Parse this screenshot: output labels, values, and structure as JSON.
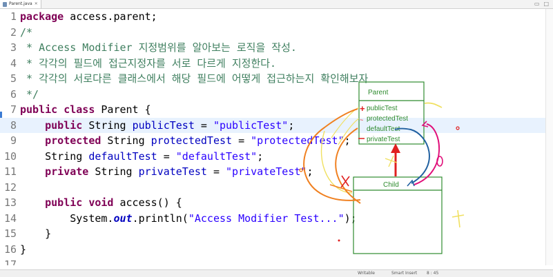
{
  "tab": {
    "title": "Parent.java",
    "close": "✕"
  },
  "window": {
    "minimize": "▭",
    "maximize": "□"
  },
  "editor": {
    "current_line": 8,
    "lines": [
      {
        "n": "1"
      },
      {
        "n": "2"
      },
      {
        "n": "3"
      },
      {
        "n": "4"
      },
      {
        "n": "5"
      },
      {
        "n": "6"
      },
      {
        "n": "7"
      },
      {
        "n": "8"
      },
      {
        "n": "9"
      },
      {
        "n": "10"
      },
      {
        "n": "11"
      },
      {
        "n": "12"
      },
      {
        "n": "13"
      },
      {
        "n": "14"
      },
      {
        "n": "15"
      },
      {
        "n": "16"
      },
      {
        "n": "17"
      }
    ],
    "tokens": {
      "package_kw": "package",
      "package_name": " access.parent;",
      "c_open": "/*",
      "c3": " * Access Modifier 지정범위를 알아보는 로직을 작성.",
      "c4": " * 각각의 필드에 접근지정자를 서로 다르게 지정한다.",
      "c5": " * 각각의 서로다른 클래스에서 해당 필드에 어떻게 접근하는지 확인해보자",
      "c_close": " */",
      "public": "public",
      "class": "class",
      "parent_decl": " Parent {",
      "protected": "protected",
      "private": "private",
      "void": "void",
      "string_type": " String ",
      "string_plain": "String ",
      "f_public": "publicTest",
      "f_protected": "protectedTest",
      "f_default": "defaultTest",
      "f_private": "privateTest",
      "assign": " = ",
      "s_public": "\"publicTest\"",
      "s_protected": "\"protectedTest\"",
      "s_default": "\"defaultTest\"",
      "s_private": "\"privateTest\"",
      "semi": ";",
      "access_sig": " access() {",
      "sysout_pre": "System.",
      "sysout_out": "out",
      "sysout_post": ".println(",
      "s_msg": "\"Access Modifier Test...\"",
      "sysout_end": ");",
      "close_brace": "}"
    }
  },
  "diagram": {
    "parent_box_title": "Parent",
    "parent_fields": [
      "publicTest",
      "protectedTest",
      "defaultTest",
      "privateTest"
    ],
    "child_box_title": "Child"
  },
  "status": {
    "writable": "Writable",
    "insert": "Smart Insert",
    "position": "8 : 45"
  },
  "colors": {
    "annotation_orange": "#f08020",
    "annotation_yellow": "#f0e060",
    "annotation_red": "#e02020",
    "annotation_magenta": "#e0107a",
    "annotation_blue": "#2060a0",
    "uml_green": "#2e8b2e"
  }
}
